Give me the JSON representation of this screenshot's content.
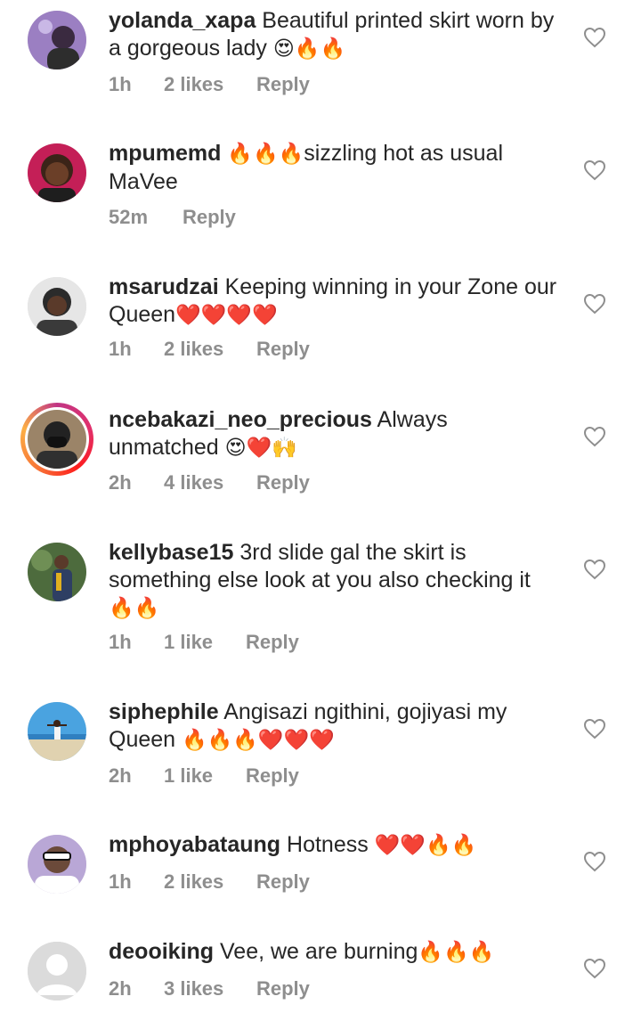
{
  "comments": [
    {
      "username": "yolanda_xapa",
      "text": " Beautiful printed skirt worn by a gorgeous lady ",
      "emoji": "😍🔥🔥",
      "time": "1h",
      "likes": "2 likes",
      "reply": "Reply",
      "avatar_colors": [
        "#9b7fc2",
        "#3a2a40"
      ]
    },
    {
      "username": "mpumemd",
      "text": " ",
      "emoji": "🔥🔥🔥",
      "text2": "sizzling hot as usual MaVee",
      "time": "52m",
      "likes": "",
      "reply": "Reply",
      "avatar_colors": [
        "#c41f57",
        "#3b2418"
      ]
    },
    {
      "username": "msarudzai",
      "text": " Keeping winning in your Zone our Queen",
      "emoji": "❤️❤️❤️❤️",
      "time": "1h",
      "likes": "2 likes",
      "reply": "Reply",
      "avatar_colors": [
        "#e6e6e6",
        "#2b2b2b"
      ]
    },
    {
      "username": "ncebakazi_neo_precious",
      "text": " Always unmatched ",
      "emoji": "😍❤️🙌",
      "time": "2h",
      "likes": "4 likes",
      "reply": "Reply",
      "avatar_colors": [
        "#9b8468",
        "#222222"
      ]
    },
    {
      "username": "kellybase15",
      "text": " 3rd slide gal the skirt is something else look at you also checking it ",
      "emoji": "🔥🔥",
      "time": "1h",
      "likes": "1 like",
      "reply": "Reply",
      "avatar_colors": [
        "#4d6b3d",
        "#2e3f63"
      ]
    },
    {
      "username": "siphephile",
      "text": " Angisazi ngithini, gojiyasi my Queen ",
      "emoji": "🔥🔥🔥❤️❤️❤️",
      "time": "2h",
      "likes": "1 like",
      "reply": "Reply",
      "avatar_colors": [
        "#4aa3e0",
        "#e0d2b0"
      ]
    },
    {
      "username": "mphoyabataung",
      "text": " Hotness ",
      "emoji": "❤️❤️🔥🔥",
      "time": "1h",
      "likes": "2 likes",
      "reply": "Reply",
      "avatar_colors": [
        "#b9a7d6",
        "#ffffff"
      ]
    },
    {
      "username": "deooiking",
      "text": " Vee, we are burning",
      "emoji": "🔥🔥🔥",
      "time": "2h",
      "likes": "3 likes",
      "reply": "Reply",
      "avatar_colors": [
        "#dbdbdb",
        "#ffffff"
      ]
    }
  ],
  "icons": {
    "like": "heart-outline-icon"
  }
}
